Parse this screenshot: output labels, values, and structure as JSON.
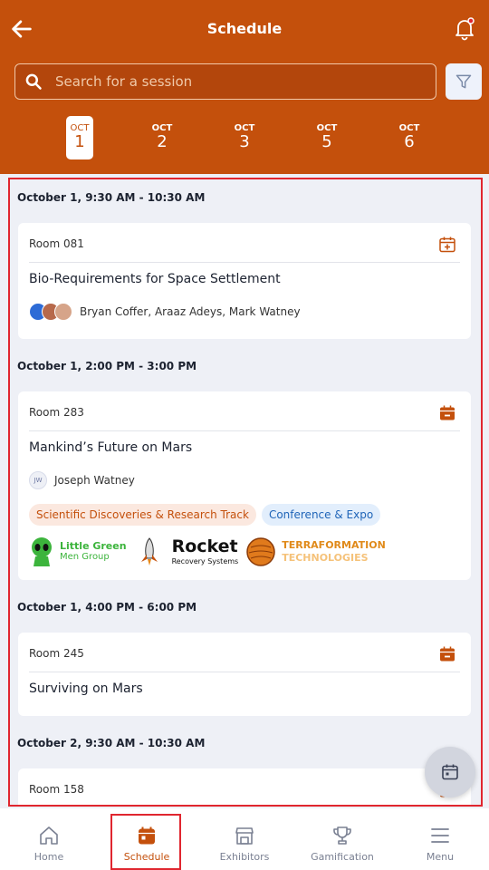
{
  "header": {
    "title": "Schedule",
    "search_placeholder": "Search for a session",
    "colors": {
      "brand": "#c4500c",
      "highlight": "#e0262f"
    }
  },
  "dates": [
    {
      "month": "OCT",
      "day": "1",
      "active": true
    },
    {
      "month": "OCT",
      "day": "2",
      "active": false
    },
    {
      "month": "OCT",
      "day": "3",
      "active": false
    },
    {
      "month": "OCT",
      "day": "5",
      "active": false
    },
    {
      "month": "OCT",
      "day": "6",
      "active": false
    }
  ],
  "slots": [
    {
      "time": "October 1, 9:30 AM - 10:30 AM",
      "room": "Room 081",
      "session_title": "Bio-Requirements for Space Settlement",
      "speakers": "Bryan Coffer, Araaz Adeys, Mark Watney",
      "calendar_icon": "calendar-plus-icon"
    },
    {
      "time": "October 1, 2:00 PM - 3:00 PM",
      "room": "Room 283",
      "session_title": "Mankind’s Future on Mars",
      "speaker_initials": "JW",
      "speakers": "Joseph Watney",
      "tags": [
        "Scientific Discoveries & Research Track",
        "Conference & Expo"
      ],
      "sponsors": [
        {
          "line1": "Little Green",
          "line2": "Men Group"
        },
        {
          "line1": "Rocket",
          "line2": "Recovery Systems"
        },
        {
          "line1": "TERRAFORMATION",
          "line2": "TECHNOLOGIES"
        }
      ],
      "calendar_icon": "calendar-minus-icon"
    },
    {
      "time": "October 1, 4:00 PM - 6:00 PM",
      "room": "Room 245",
      "session_title": "Surviving on Mars",
      "calendar_icon": "calendar-minus-icon"
    },
    {
      "time": "October 2, 9:30 AM - 10:30 AM",
      "room": "Room 158"
    }
  ],
  "bottom_nav": [
    {
      "label": "Home",
      "icon": "home-icon"
    },
    {
      "label": "Schedule",
      "icon": "calendar-icon",
      "active": true
    },
    {
      "label": "Exhibitors",
      "icon": "store-icon"
    },
    {
      "label": "Gamification",
      "icon": "trophy-icon"
    },
    {
      "label": "Menu",
      "icon": "menu-icon"
    }
  ]
}
